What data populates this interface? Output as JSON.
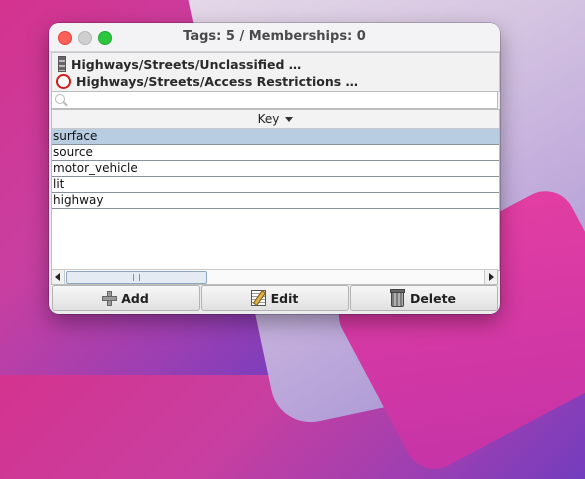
{
  "window": {
    "title": "Tags: 5 / Memberships: 0"
  },
  "presets": [
    {
      "label": "Highways/Streets/Unclassified …",
      "icon": "road-icon"
    },
    {
      "label": "Highways/Streets/Access Restrictions …",
      "icon": "restriction-circle-icon"
    }
  ],
  "search": {
    "value": "",
    "placeholder": ""
  },
  "table": {
    "column_header": "Key",
    "rows": [
      "surface",
      "source",
      "motor_vehicle",
      "lit",
      "highway"
    ],
    "selected_row": "surface"
  },
  "buttons": {
    "add": "Add",
    "edit": "Edit",
    "delete": "Delete"
  },
  "colors": {
    "selection": "#b9cde2",
    "close": "#fe5f57",
    "maximize": "#2ac73f"
  }
}
